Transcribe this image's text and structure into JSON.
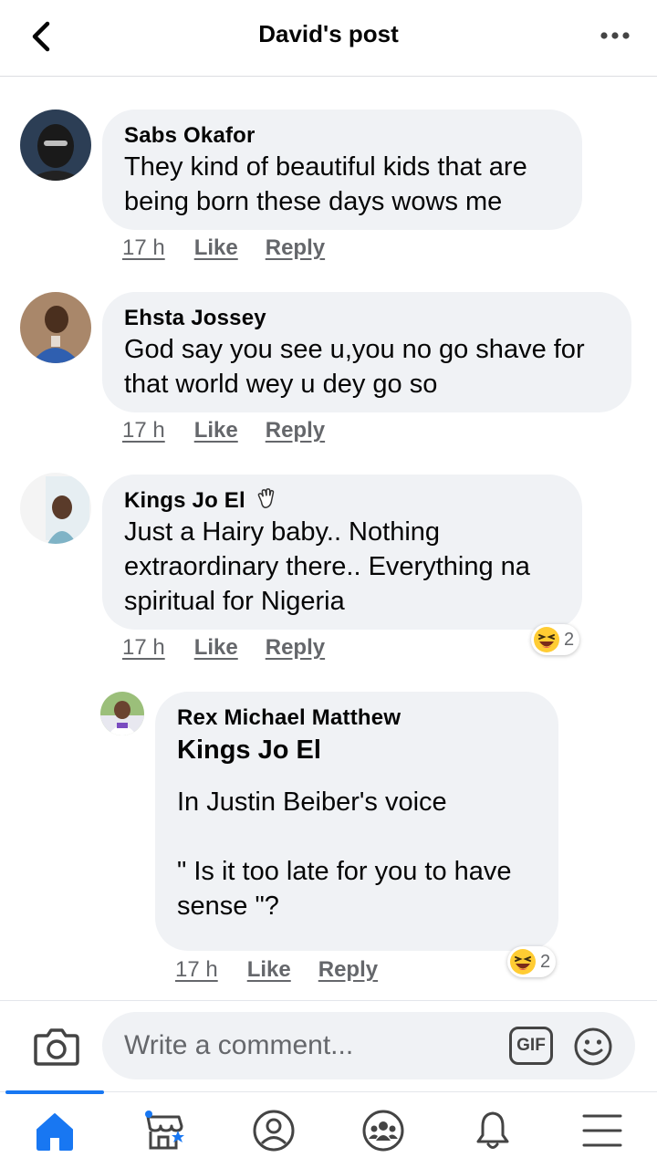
{
  "header": {
    "title": "David's post"
  },
  "comments": [
    {
      "author": "Sabs Okafor",
      "text": "They kind of beautiful kids that are\nbeing born these days wows me",
      "time": "17 h",
      "like": "Like",
      "reply": "Reply"
    },
    {
      "author": "Ehsta Jossey",
      "text": "God say you see u,you no go shave for\nthat world wey u dey go so",
      "time": "17 h",
      "like": "Like",
      "reply": "Reply"
    },
    {
      "author": "Kings Jo El",
      "text": "Just a Hairy baby.. Nothing\nextraordinary there.. Everything na\nspiritual for Nigeria",
      "time": "17 h",
      "like": "Like",
      "reply": "Reply",
      "reaction_count": "2"
    }
  ],
  "reply": {
    "author": "Rex Michael Matthew",
    "tagged": "Kings Jo El",
    "text": "In Justin Beiber's voice\n\n\" Is it too late for you to have\nsense \"?",
    "time": "17 h",
    "like": "Like",
    "reply": "Reply",
    "reaction_count": "2"
  },
  "composer": {
    "placeholder": "Write a comment...",
    "gif_label": "GIF"
  },
  "colors": {
    "accent": "#1877f2",
    "bubble": "#f0f2f5",
    "secondary_text": "#65676b"
  },
  "icons": [
    "back-icon",
    "more-icon",
    "camera-icon",
    "gif-icon",
    "emoji-icon",
    "home-icon",
    "marketplace-icon",
    "profile-icon",
    "groups-icon",
    "notifications-icon",
    "menu-icon"
  ]
}
